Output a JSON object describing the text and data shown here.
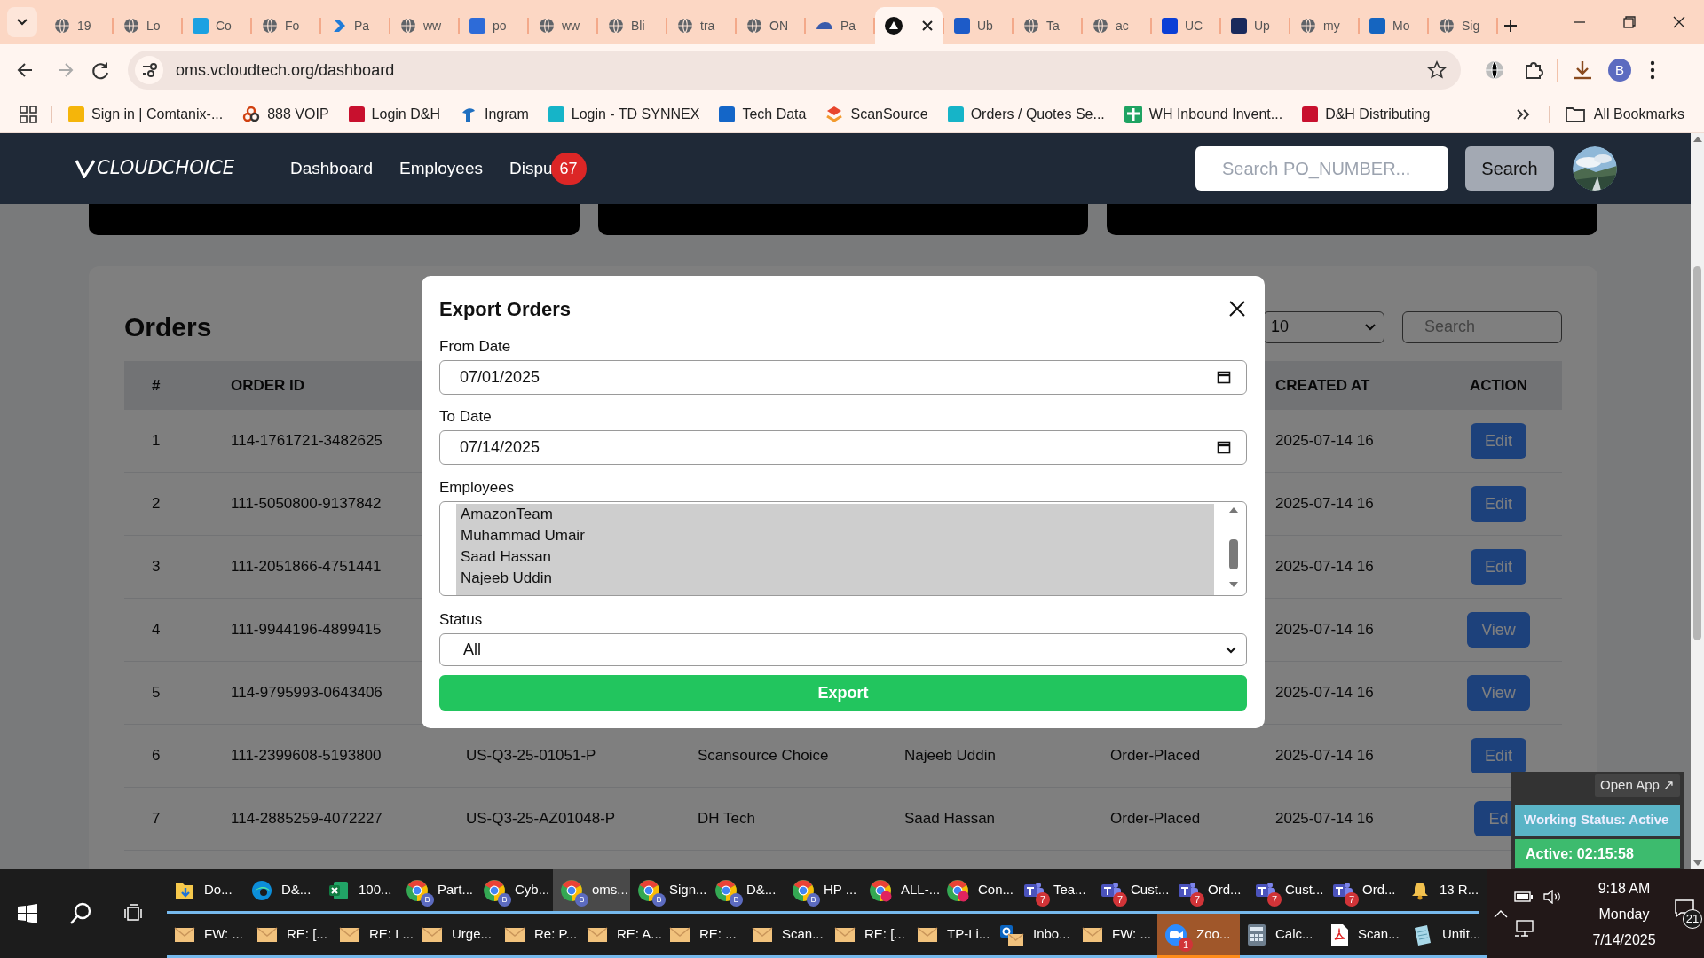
{
  "browser": {
    "tabs": [
      {
        "label": "19",
        "selected": false
      },
      {
        "label": "Lo",
        "selected": false
      },
      {
        "label": "Co",
        "selected": false
      },
      {
        "label": "Fo",
        "selected": false
      },
      {
        "label": "Pa",
        "selected": false
      },
      {
        "label": "ww",
        "selected": false
      },
      {
        "label": "po",
        "selected": false
      },
      {
        "label": "ww",
        "selected": false
      },
      {
        "label": "Bli",
        "selected": false
      },
      {
        "label": "tra",
        "selected": false
      },
      {
        "label": "ON",
        "selected": false
      },
      {
        "label": "Pa",
        "selected": false
      },
      {
        "selected": true
      },
      {
        "label": "Ub",
        "selected": false
      },
      {
        "label": "Ta",
        "selected": false
      },
      {
        "label": "ac",
        "selected": false
      },
      {
        "label": "UC",
        "selected": false
      },
      {
        "label": "Up",
        "selected": false
      },
      {
        "label": "my",
        "selected": false
      },
      {
        "label": "Mo",
        "selected": false
      },
      {
        "label": "Sig",
        "selected": false
      }
    ],
    "url": "oms.vcloudtech.org/dashboard",
    "profile_initial": "B",
    "bookmarks": [
      "Sign in | Comtanix-...",
      "888 VOIP",
      "Login D&H",
      "Ingram",
      "Login - TD SYNNEX",
      "Tech Data",
      "ScanSource",
      "Orders / Quotes Se...",
      "WH Inbound Invent...",
      "D&H Distributing"
    ],
    "all_bookmarks": "All Bookmarks"
  },
  "navbar": {
    "logo": "CLOUDCHOICE",
    "links": [
      {
        "label": "Dashboard"
      },
      {
        "label": "Employees"
      },
      {
        "label": "Dispu",
        "badge": "67"
      }
    ],
    "search": {
      "placeholder": "Search PO_NUMBER..."
    },
    "search_button": "Search"
  },
  "orders": {
    "title": "Orders",
    "page_size": "10",
    "search": {
      "placeholder": "Search"
    },
    "columns": {
      "number": "#",
      "order_id": "ORDER ID",
      "created_at": "CREATED AT",
      "action": "ACTION"
    },
    "rows": [
      {
        "number": "1",
        "order_id": "114-1761721-3482625",
        "created_at": "2025-07-14 16",
        "action": "Edit"
      },
      {
        "number": "2",
        "order_id": "111-5050800-9137842",
        "created_at": "2025-07-14 16",
        "action": "Edit"
      },
      {
        "number": "3",
        "order_id": "111-2051866-4751441",
        "created_at": "2025-07-14 16",
        "action": "Edit"
      },
      {
        "number": "4",
        "order_id": "111-9944196-4899415",
        "created_at": "2025-07-14 16",
        "action": "View"
      },
      {
        "number": "5",
        "order_id": "114-9795993-0643406",
        "created_at": "2025-07-14 16",
        "action": "View"
      },
      {
        "number": "6",
        "order_id": "111-2399608-5193800",
        "column_3": "US-Q3-25-01051-P",
        "column_4": "Scansource Choice",
        "column_5": "Najeeb Uddin",
        "column_6": "Order-Placed",
        "created_at": "2025-07-14 16",
        "action": "Edit"
      },
      {
        "number": "7",
        "order_id": "114-2885259-4072227",
        "column_3": "US-Q3-25-AZ01048-P",
        "column_4": "DH Tech",
        "column_5": "Saad Hassan",
        "column_6": "Order-Placed",
        "created_at": "2025-07-14 16",
        "action": "Ed"
      }
    ]
  },
  "modal": {
    "title": "Export Orders",
    "from_label": "From Date",
    "from_value": "07/01/2025",
    "to_label": "To Date",
    "to_value": "07/14/2025",
    "employees_label": "Employees",
    "employees": [
      {
        "label": "AmazonTeam",
        "selected": true
      },
      {
        "label": "Muhammad Umair",
        "selected": true
      },
      {
        "label": "Saad Hassan",
        "selected": true
      },
      {
        "label": "Najeeb Uddin",
        "selected": true
      }
    ],
    "status_label": "Status",
    "status_value": "All",
    "export_button": "Export"
  },
  "widget": {
    "open_app": "Open App ↗",
    "working_status": "Working Status: Active",
    "timer": "Active: 02:15:58"
  },
  "taskbar": {
    "row_1": [
      {
        "label": "Do...",
        "selected": false
      },
      {
        "label": "D&...",
        "selected": false
      },
      {
        "label": "100...",
        "selected": false
      },
      {
        "label": "Part...",
        "profile": "B",
        "selected": false
      },
      {
        "label": "Cyb...",
        "profile": "B",
        "selected": false
      },
      {
        "label": "oms...",
        "profile": "B",
        "selected": true
      },
      {
        "label": "Sign...",
        "profile": "B",
        "selected": false
      },
      {
        "label": "D&...",
        "profile": "B",
        "selected": false
      },
      {
        "label": "HP ...",
        "profile": "B",
        "selected": false
      },
      {
        "label": "ALL-...",
        "selected": false
      },
      {
        "label": "Con...",
        "selected": false
      },
      {
        "label": "Tea...",
        "badge": "7",
        "selected": false
      },
      {
        "label": "Cust...",
        "badge": "7",
        "selected": false
      },
      {
        "label": "Ord...",
        "badge": "7",
        "selected": false
      },
      {
        "label": "Cust...",
        "badge": "7",
        "selected": false
      },
      {
        "label": "Ord...",
        "badge": "7",
        "selected": false
      },
      {
        "label": "13 R...",
        "selected": false
      }
    ],
    "row_2": [
      {
        "label": "FW: ...",
        "selected": false
      },
      {
        "label": "RE: [...",
        "selected": false
      },
      {
        "label": "RE: L...",
        "selected": false
      },
      {
        "label": "Urge...",
        "selected": false
      },
      {
        "label": "Re: P...",
        "selected": false
      },
      {
        "label": "RE: A...",
        "selected": false
      },
      {
        "label": "RE: ...",
        "selected": false
      },
      {
        "label": "Scan...",
        "selected": false
      },
      {
        "label": "RE: [...",
        "selected": false
      },
      {
        "label": "TP-Li...",
        "selected": false
      },
      {
        "label": "Inbo...",
        "selected": false
      },
      {
        "label": "FW: ...",
        "selected": false
      },
      {
        "label": "Zoo...",
        "badge": "1",
        "selected": true
      },
      {
        "label": "Calc...",
        "selected": false
      },
      {
        "label": "Scan...",
        "selected": false
      },
      {
        "label": "Untit...",
        "selected": false
      }
    ],
    "time": "9:18 AM",
    "day": "Monday",
    "date": "7/14/2025",
    "notifications": "21"
  }
}
